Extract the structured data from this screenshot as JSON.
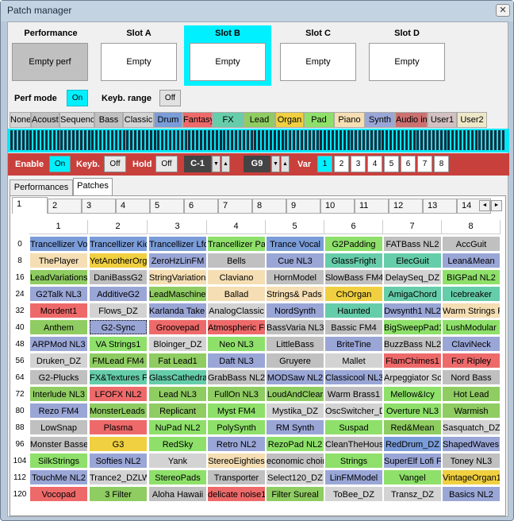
{
  "window": {
    "title": "Patch manager",
    "close_icon": "✕"
  },
  "slots": [
    {
      "header": "Performance",
      "value": "Empty perf"
    },
    {
      "header": "Slot A",
      "value": "Empty"
    },
    {
      "header": "Slot B",
      "value": "Empty"
    },
    {
      "header": "Slot C",
      "value": "Empty"
    },
    {
      "header": "Slot D",
      "value": "Empty"
    }
  ],
  "perf_mode": {
    "label": "Perf mode",
    "value": "On"
  },
  "keyb_range": {
    "label": "Keyb. range",
    "value": "Off"
  },
  "categories": [
    {
      "label": "None",
      "color": "#d3d3d3"
    },
    {
      "label": "Acoustic",
      "color": "#c0c0c0"
    },
    {
      "label": "Sequencer",
      "color": "#d3d3d3"
    },
    {
      "label": "Bass",
      "color": "#c0c0c0"
    },
    {
      "label": "Classic",
      "color": "#d3d3d3"
    },
    {
      "label": "Drum",
      "color": "#7a9cd8"
    },
    {
      "label": "Fantasy",
      "color": "#ee6a6a"
    },
    {
      "label": "FX",
      "color": "#66cdaa"
    },
    {
      "label": "Lead",
      "color": "#8fcc62"
    },
    {
      "label": "Organ",
      "color": "#f0d040"
    },
    {
      "label": "Pad",
      "color": "#8ee06a"
    },
    {
      "label": "Piano",
      "color": "#f5deb3"
    },
    {
      "label": "Synth",
      "color": "#9aa6d6"
    },
    {
      "label": "Audio in",
      "color": "#cc7070"
    },
    {
      "label": "User1",
      "color": "#d3c1c1"
    },
    {
      "label": "User2",
      "color": "#eee8c8"
    }
  ],
  "redbar": {
    "enable": {
      "label": "Enable",
      "value": "On"
    },
    "keyb": {
      "label": "Keyb.",
      "value": "Off"
    },
    "hold": {
      "label": "Hold",
      "value": "Off"
    },
    "low_key": "C-1",
    "high_key": "G9",
    "var_label": "Var",
    "variations": [
      "1",
      "2",
      "3",
      "4",
      "5",
      "6",
      "7",
      "8"
    ],
    "selected_variation": "1"
  },
  "main_tabs": [
    "Performances",
    "Patches"
  ],
  "bank_tabs": [
    "1",
    "2",
    "3",
    "4",
    "5",
    "6",
    "7",
    "8",
    "9",
    "10",
    "11",
    "12",
    "13",
    "14"
  ],
  "scroll_left_icon": "◄",
  "scroll_right_icon": "►",
  "columns": [
    "1",
    "2",
    "3",
    "4",
    "5",
    "6",
    "7",
    "8"
  ],
  "rows": [
    {
      "n": "0",
      "cells": [
        [
          "Trancellizer Voc",
          "Drum"
        ],
        [
          "Trancellizer Kick",
          "Drum"
        ],
        [
          "Trancellizer Lfo",
          "Drum"
        ],
        [
          "Trancellizer Pad",
          "Pad"
        ],
        [
          "Trance Vocal",
          "Drum"
        ],
        [
          "G2Padding",
          "Pad"
        ],
        [
          "FATBass NL2",
          "Bass"
        ],
        [
          "AccGuit",
          "Acoustic"
        ]
      ]
    },
    {
      "n": "8",
      "cells": [
        [
          "ThePlayer",
          "Piano"
        ],
        [
          "YetAnotherOrgan",
          "Organ"
        ],
        [
          "ZeroHzLinFM",
          "Synth"
        ],
        [
          "Bells",
          "Acoustic"
        ],
        [
          "Cue NL3",
          "Synth"
        ],
        [
          "GlassFright",
          "FX"
        ],
        [
          "ElecGuit",
          "FX"
        ],
        [
          "Lean&Mean",
          "Synth"
        ]
      ]
    },
    {
      "n": "16",
      "cells": [
        [
          "LeadVariations",
          "Lead"
        ],
        [
          "DaniBassG2",
          "Bass"
        ],
        [
          "StringVariations",
          "Piano"
        ],
        [
          "Claviano",
          "Piano"
        ],
        [
          "HornModel",
          "Acoustic"
        ],
        [
          "SlowBass FM4",
          "Bass"
        ],
        [
          "DelaySeq_DZ",
          "Sequencer"
        ],
        [
          "BIGPad NL2",
          "Pad"
        ]
      ]
    },
    {
      "n": "24",
      "cells": [
        [
          "G2Talk NL3",
          "Synth"
        ],
        [
          "AdditiveG2",
          "Synth"
        ],
        [
          "LeadMaschine DZ",
          "Lead"
        ],
        [
          "Ballad",
          "Piano"
        ],
        [
          "Strings& Pads NL3",
          "Piano"
        ],
        [
          "ChOrgan",
          "Organ"
        ],
        [
          "AmigaChord",
          "FX"
        ],
        [
          "Icebreaker",
          "FX"
        ]
      ]
    },
    {
      "n": "32",
      "cells": [
        [
          "Mordent1",
          "Fantasy"
        ],
        [
          "Flows_DZ",
          "Classic"
        ],
        [
          "Karlanda Take Off",
          "Synth"
        ],
        [
          "AnalogClassic",
          "Classic"
        ],
        [
          "NordSynth",
          "Synth"
        ],
        [
          "Haunted",
          "FX"
        ],
        [
          "Dwsynth1 NL2",
          "Synth"
        ],
        [
          "Warm Strings FM4",
          "Piano"
        ]
      ]
    },
    {
      "n": "40",
      "cells": [
        [
          "Anthem",
          "Lead"
        ],
        [
          "G2-Sync",
          "Synth"
        ],
        [
          "Groovepad",
          "Fantasy"
        ],
        [
          "Atmospheric FM4",
          "Fantasy"
        ],
        [
          "BassVaria NL3",
          "Bass"
        ],
        [
          "Bassic FM4",
          "Bass"
        ],
        [
          "BigSweepPad1",
          "Pad"
        ],
        [
          "LushModular",
          "Pad"
        ]
      ]
    },
    {
      "n": "48",
      "cells": [
        [
          "ARPMod NL3",
          "Synth"
        ],
        [
          "VA Strings1",
          "Pad"
        ],
        [
          "Bloinger_DZ",
          "Classic"
        ],
        [
          "Neo NL3",
          "Pad"
        ],
        [
          "LittleBass",
          "Bass"
        ],
        [
          "BriteTine",
          "Synth"
        ],
        [
          "BuzzBass NL2",
          "Bass"
        ],
        [
          "ClaviNeck",
          "Synth"
        ]
      ]
    },
    {
      "n": "56",
      "cells": [
        [
          "Druken_DZ",
          "Classic"
        ],
        [
          "FMLead FM4",
          "Lead"
        ],
        [
          "Fat Lead1",
          "Lead"
        ],
        [
          "Daft NL3",
          "Synth"
        ],
        [
          "Gruyere",
          "Bass"
        ],
        [
          "Mallet",
          "Classic"
        ],
        [
          "FlamChimes1",
          "Fantasy"
        ],
        [
          "For Ripley",
          "Fantasy"
        ]
      ]
    },
    {
      "n": "64",
      "cells": [
        [
          "G2-Plucks",
          "Acoustic"
        ],
        [
          "FX&Textures FM4",
          "FX"
        ],
        [
          "GlassCathedral",
          "FX"
        ],
        [
          "GrabBass NL2",
          "Bass"
        ],
        [
          "MODSaw NL2",
          "Synth"
        ],
        [
          "Classicool NL3",
          "Synth"
        ],
        [
          "Arpeggiator Sound",
          "Sequencer"
        ],
        [
          "Nord Bass",
          "Bass"
        ]
      ]
    },
    {
      "n": "72",
      "cells": [
        [
          "Interlude NL3",
          "Lead"
        ],
        [
          "LFOFX NL2",
          "Fantasy"
        ],
        [
          "Lead NL3",
          "Lead"
        ],
        [
          "FullOn NL3",
          "Lead"
        ],
        [
          "LoudAndClear",
          "Lead"
        ],
        [
          "Warm Brass1",
          "Acoustic"
        ],
        [
          "Mellow&Icy",
          "Pad"
        ],
        [
          "Hot Lead",
          "Lead"
        ]
      ]
    },
    {
      "n": "80",
      "cells": [
        [
          "Rezo FM4",
          "Synth"
        ],
        [
          "MonsterLeads NL3",
          "Lead"
        ],
        [
          "Replicant",
          "Lead"
        ],
        [
          "Myst FM4",
          "Pad"
        ],
        [
          "Mystika_DZ",
          "Classic"
        ],
        [
          "OscSwitcher_DZ",
          "Classic"
        ],
        [
          "Overture NL3",
          "Pad"
        ],
        [
          "Warmish",
          "Lead"
        ]
      ]
    },
    {
      "n": "88",
      "cells": [
        [
          "LowSnap",
          "Acoustic"
        ],
        [
          "Plasma",
          "Fantasy"
        ],
        [
          "NuPad NL2",
          "Pad"
        ],
        [
          "PolySynth",
          "Pad"
        ],
        [
          "RM Synth",
          "Synth"
        ],
        [
          "Suspad",
          "Pad"
        ],
        [
          "Red&Mean",
          "Lead"
        ],
        [
          "Sasquatch_DZ",
          "Classic"
        ]
      ]
    },
    {
      "n": "96",
      "cells": [
        [
          "Monster Basses",
          "Bass"
        ],
        [
          "G3",
          "Organ"
        ],
        [
          "RedSky",
          "Pad"
        ],
        [
          "Retro NL2",
          "Synth"
        ],
        [
          "RezoPad NL2",
          "Pad"
        ],
        [
          "CleanTheHouse",
          "Bass"
        ],
        [
          "RedDrum_DZ",
          "Drum"
        ],
        [
          "ShapedWavesMod",
          "Synth"
        ]
      ]
    },
    {
      "n": "104",
      "cells": [
        [
          "SilkStrings",
          "Pad"
        ],
        [
          "Softies NL2",
          "Synth"
        ],
        [
          "Yank",
          "Classic"
        ],
        [
          "StereoEighties",
          "Piano"
        ],
        [
          "economic choir",
          "Acoustic"
        ],
        [
          "Strings",
          "Pad"
        ],
        [
          "SuperElf Lofi FX",
          "Synth"
        ],
        [
          "Toney NL3",
          "Bass"
        ]
      ]
    },
    {
      "n": "112",
      "cells": [
        [
          "TouchMe NL2",
          "Synth"
        ],
        [
          "Trance2_DZLW",
          "Classic"
        ],
        [
          "StereoPads",
          "Pad"
        ],
        [
          "Transporter",
          "Bass"
        ],
        [
          "Select120_DZ",
          "Classic"
        ],
        [
          "LinFMModel",
          "Synth"
        ],
        [
          "Vangel",
          "Pad"
        ],
        [
          "VintageOrgan1",
          "Organ"
        ]
      ]
    },
    {
      "n": "120",
      "cells": [
        [
          "Vocopad",
          "Fantasy"
        ],
        [
          "3 Filter",
          "Lead"
        ],
        [
          "Aloha Hawaii",
          "Acoustic"
        ],
        [
          "delicate noise1",
          "Fantasy"
        ],
        [
          "Filter Sureal",
          "Lead"
        ],
        [
          "ToBee_DZ",
          "Classic"
        ],
        [
          "Transz_DZ",
          "Classic"
        ],
        [
          "Basics NL2",
          "Synth"
        ]
      ]
    }
  ],
  "selected_cell": "G2-Sync"
}
